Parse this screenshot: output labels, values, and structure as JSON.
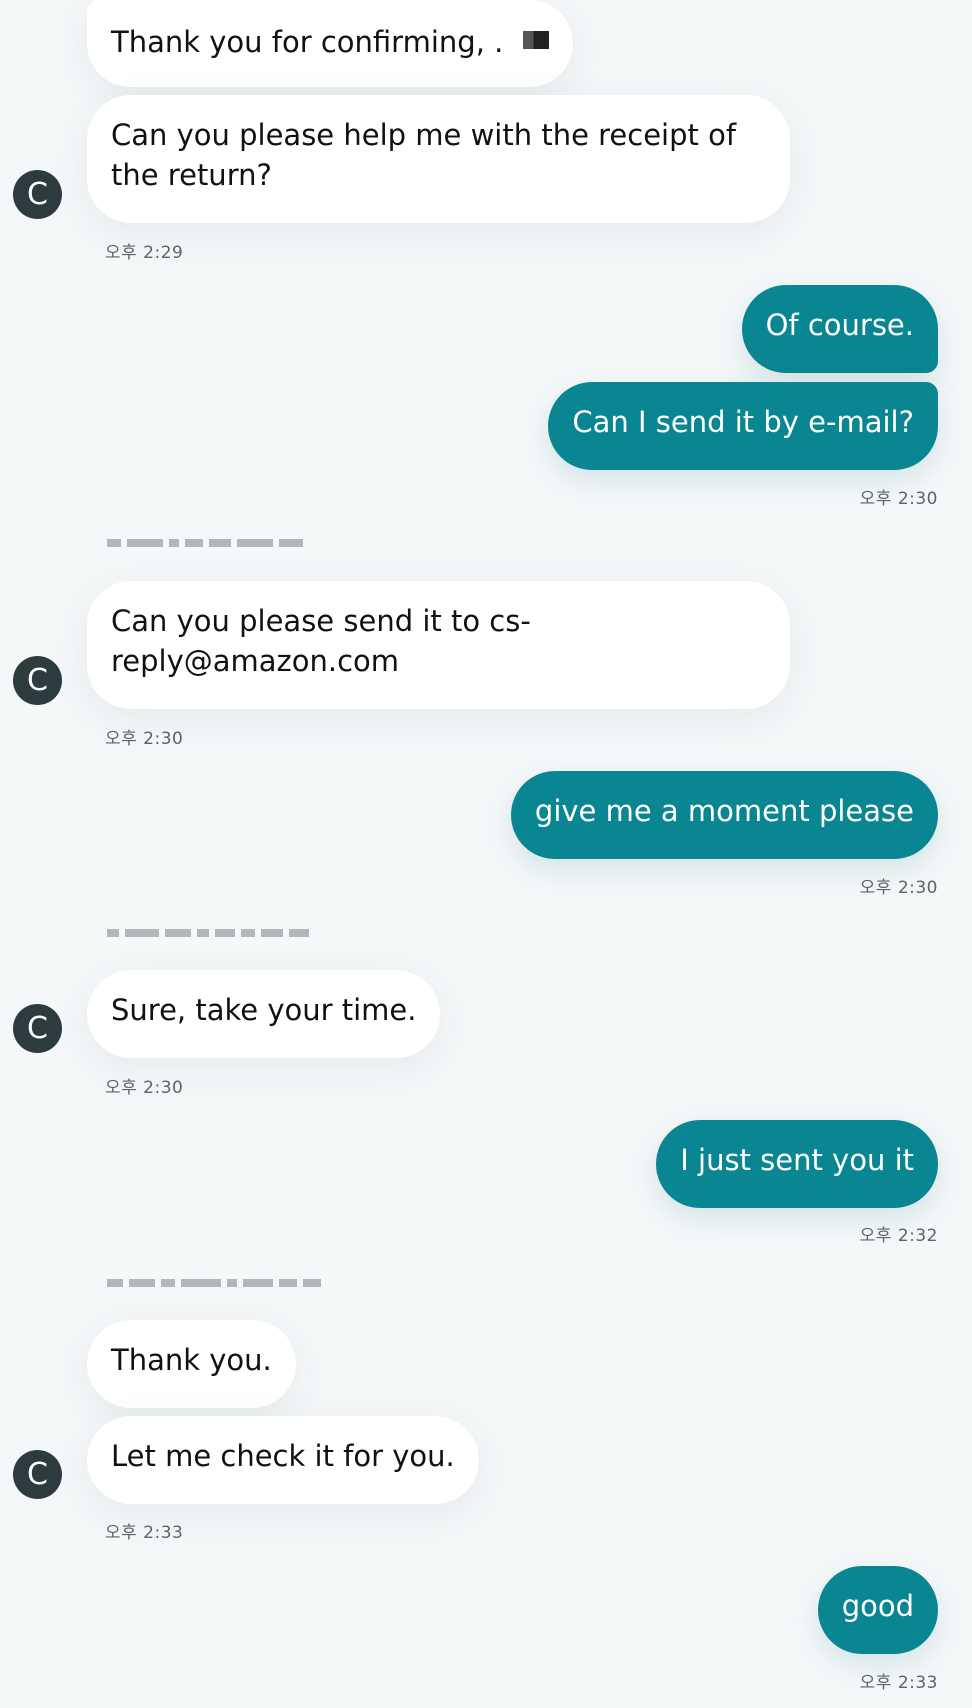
{
  "messages": {
    "m1": {
      "text": "Thank you for confirming, ."
    },
    "m2": {
      "text": "Can you please help me with the receipt of the return?"
    },
    "t1": "오후 2:29",
    "m3": {
      "text": "Of course."
    },
    "m4": {
      "text": "Can I send it by e-mail?"
    },
    "t2": "오후 2:30",
    "m5": {
      "text": "Can you please send it to cs-reply@amazon.com"
    },
    "t3": "오후 2:30",
    "m6": {
      "text": "give me a moment please"
    },
    "t4": "오후 2:30",
    "m7": {
      "text": "Sure, take your time."
    },
    "t5": "오후 2:30",
    "m8": {
      "text": "I just sent you it"
    },
    "t6": "오후 2:32",
    "m9": {
      "text": "Thank you."
    },
    "m10": {
      "text": "Let me check it for you."
    },
    "t7": "오후 2:33",
    "m11": {
      "text": "good"
    },
    "t8": "오후 2:33"
  },
  "agent": {
    "avatar_letter": "C"
  }
}
